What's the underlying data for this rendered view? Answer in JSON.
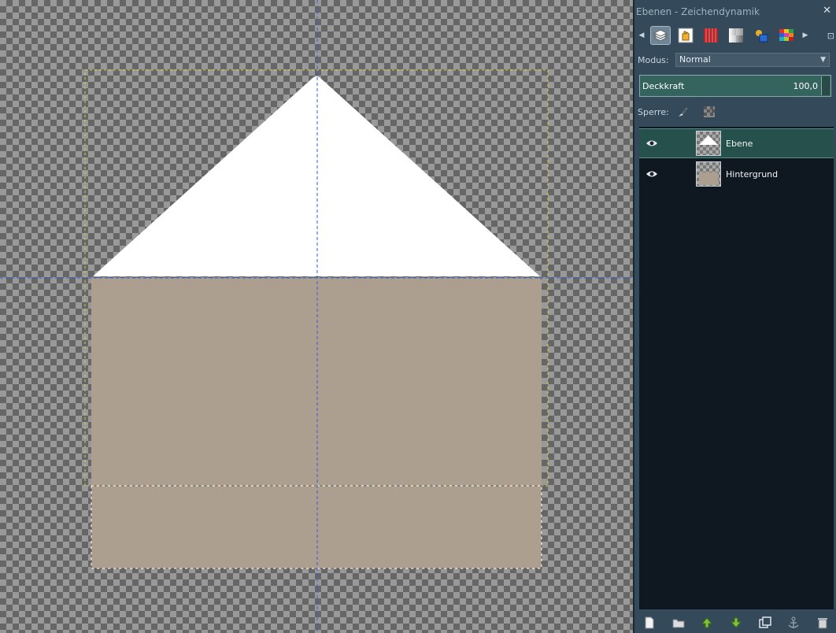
{
  "canvas": {
    "background_color": "#ad9f8f",
    "shape_color": "#ffffff"
  },
  "dock": {
    "title": "Ebenen - Zeichendynamik",
    "close_label": "✕",
    "tabs": [
      {
        "icon": "layers-icon",
        "active": true
      },
      {
        "icon": "hand-icon"
      },
      {
        "icon": "curtain-icon"
      },
      {
        "icon": "checker-gradient-icon"
      },
      {
        "icon": "shapes-icon"
      },
      {
        "icon": "palette-icon"
      }
    ],
    "mode_label": "Modus:",
    "mode_value": "Normal",
    "opacity_label": "Deckkraft",
    "opacity_value": "100,0",
    "lock_label": "Sperre:",
    "layers": [
      {
        "name": "Ebene",
        "selected": true,
        "visible": true
      },
      {
        "name": "Hintergrund",
        "selected": false,
        "visible": true
      }
    ],
    "bottom_buttons": [
      "new-layer-icon",
      "folder-icon",
      "raise-layer-icon",
      "lower-layer-icon",
      "duplicate-layer-icon",
      "anchor-icon",
      "delete-icon"
    ]
  }
}
